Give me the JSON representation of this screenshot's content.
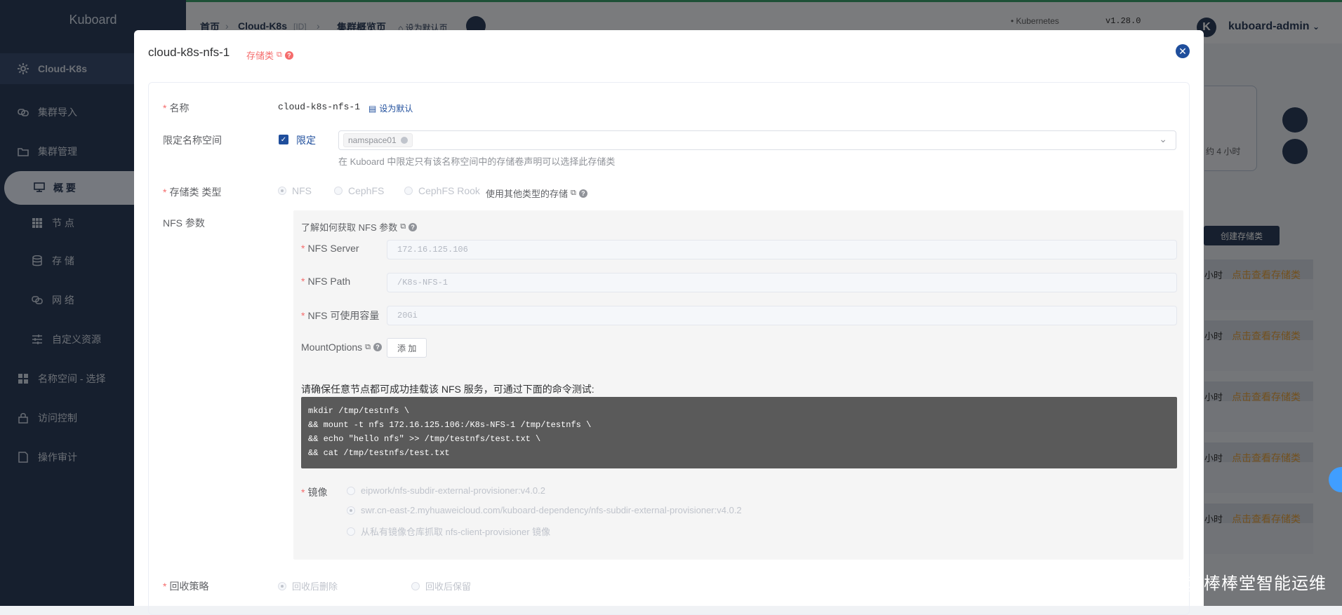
{
  "app": {
    "brand": "Kuboard"
  },
  "sidebar": {
    "items": [
      {
        "label": "Cloud-K8s",
        "icon": "gear-icon"
      },
      {
        "label": "集群导入",
        "icon": "link-icon"
      },
      {
        "label": "集群管理",
        "icon": "folder-icon"
      },
      {
        "label": "概 要",
        "icon": "monitor-icon"
      },
      {
        "label": "节 点",
        "icon": "grid-icon"
      },
      {
        "label": "存 储",
        "icon": "database-icon"
      },
      {
        "label": "网 络",
        "icon": "network-icon"
      },
      {
        "label": "自定义资源",
        "icon": "sliders-icon"
      },
      {
        "label": "名称空间 - 选择",
        "icon": "apps-icon"
      },
      {
        "label": "访问控制",
        "icon": "lock-icon"
      },
      {
        "label": "操作审计",
        "icon": "audit-icon"
      }
    ]
  },
  "topbar": {
    "crumbs": [
      "首页",
      "Cloud-K8s",
      "[ID]",
      "集群概览页"
    ],
    "set_default": "设为默认页",
    "kube_label": "Kubernetes",
    "kube_version": "v1.28.0",
    "user": "kuboard-admin",
    "avatar": "K"
  },
  "background": {
    "create_btn": "创建存储类",
    "row_hours": "小时",
    "row_link": "点击查看存储类",
    "card_text": "约 4 小时"
  },
  "dialog": {
    "title": "cloud-k8s-nfs-1",
    "kind": "存储类",
    "fields": {
      "name_label": "名称",
      "name_value": "cloud-k8s-nfs-1",
      "set_default": "设为默认",
      "ns_label": "限定名称空间",
      "ns_check": "限定",
      "ns_tag": "namspace01",
      "ns_hint": "在 Kuboard 中限定只有该名称空间中的存储卷声明可以选择此存储类",
      "type_label": "存储类 类型",
      "types": [
        "NFS",
        "CephFS",
        "CephFS Rook"
      ],
      "other_types": "使用其他类型的存储",
      "nfs_label": "NFS 参数",
      "nfs_howto": "了解如何获取 NFS 参数",
      "server_label": "NFS Server",
      "server_value": "172.16.125.106",
      "path_label": "NFS Path",
      "path_value": "/K8s-NFS-1",
      "cap_label": "NFS 可使用容量",
      "cap_value": "20Gi",
      "mount_label": "MountOptions",
      "add_btn": "添 加",
      "mount_note": "请确保任意节点都可成功挂载该 NFS 服务，可通过下面的命令测试:",
      "code_lines": [
        "mkdir /tmp/testnfs \\",
        "&& mount -t nfs 172.16.125.106:/K8s-NFS-1 /tmp/testnfs \\",
        "&& echo \"hello nfs\" >> /tmp/testnfs/test.txt \\",
        "&& cat /tmp/testnfs/test.txt"
      ],
      "image_label": "镜像",
      "images": [
        "eipwork/nfs-subdir-external-provisioner:v4.0.2",
        "swr.cn-east-2.myhuaweicloud.com/kuboard-dependency/nfs-subdir-external-provisioner:v4.0.2",
        "从私有镜像仓库抓取 nfs-client-provisioner 镜像"
      ],
      "reclaim_label": "回收策略",
      "reclaim": [
        "回收后删除",
        "回收后保留"
      ]
    }
  },
  "watermark": "掘金技术社区 @ 棒棒堂智能运维"
}
